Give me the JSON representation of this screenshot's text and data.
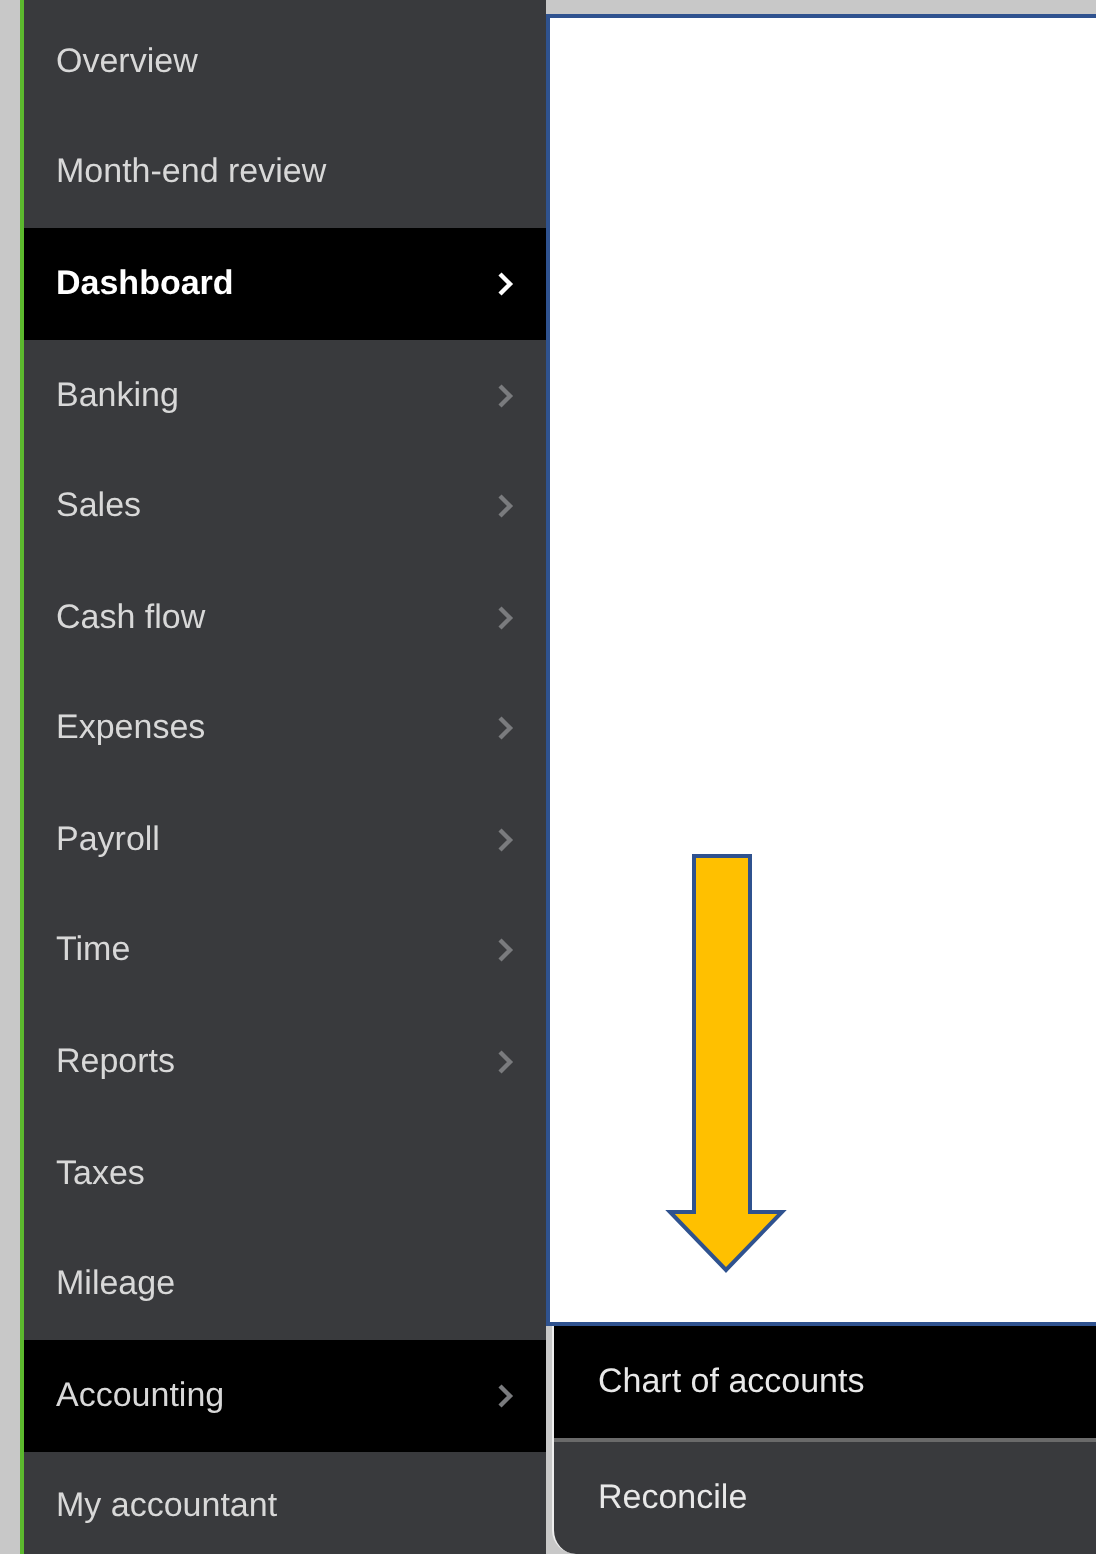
{
  "sidebar": {
    "items": [
      {
        "label": "Overview",
        "chevron": false,
        "selected": false,
        "expanded": false
      },
      {
        "label": "Month-end review",
        "chevron": false,
        "selected": false,
        "expanded": false
      },
      {
        "label": "Dashboard",
        "chevron": true,
        "selected": true,
        "expanded": false
      },
      {
        "label": "Banking",
        "chevron": true,
        "selected": false,
        "expanded": false
      },
      {
        "label": "Sales",
        "chevron": true,
        "selected": false,
        "expanded": false
      },
      {
        "label": "Cash flow",
        "chevron": true,
        "selected": false,
        "expanded": false
      },
      {
        "label": "Expenses",
        "chevron": true,
        "selected": false,
        "expanded": false
      },
      {
        "label": "Payroll",
        "chevron": true,
        "selected": false,
        "expanded": false
      },
      {
        "label": "Time",
        "chevron": true,
        "selected": false,
        "expanded": false
      },
      {
        "label": "Reports",
        "chevron": true,
        "selected": false,
        "expanded": false
      },
      {
        "label": "Taxes",
        "chevron": false,
        "selected": false,
        "expanded": false
      },
      {
        "label": "Mileage",
        "chevron": false,
        "selected": false,
        "expanded": false
      },
      {
        "label": "Accounting",
        "chevron": true,
        "selected": false,
        "expanded": true
      },
      {
        "label": "My accountant",
        "chevron": false,
        "selected": false,
        "expanded": false
      }
    ]
  },
  "submenu": {
    "items": [
      {
        "label": "Chart of accounts",
        "selected": true
      },
      {
        "label": "Reconcile",
        "selected": false
      }
    ]
  }
}
